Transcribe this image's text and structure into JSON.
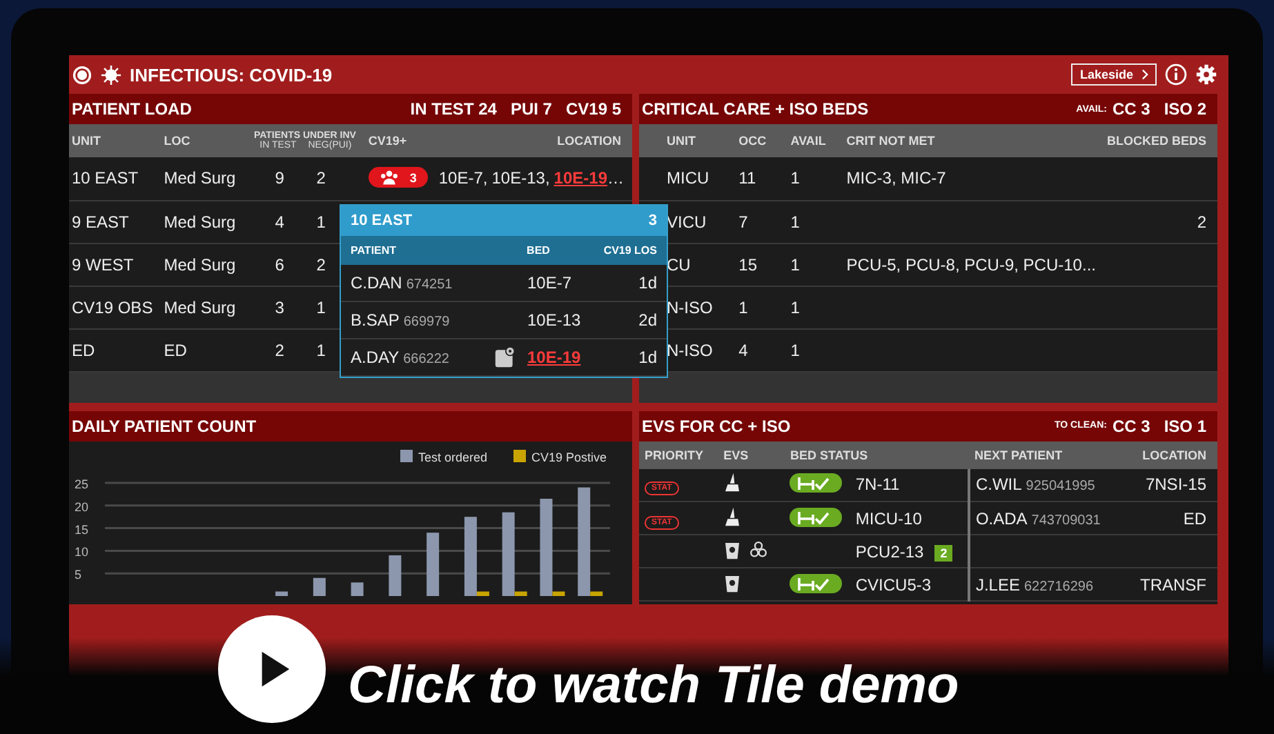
{
  "app_bar": {
    "title": "INFECTIOUS: COVID-19",
    "site_button": "Lakeside"
  },
  "patient_load": {
    "title": "PATIENT LOAD",
    "stats": [
      "IN TEST 24",
      "PUI 7",
      "CV19 5"
    ],
    "columns": {
      "unit": "UNIT",
      "loc": "LOC",
      "group": "PATIENTS UNDER INV",
      "in_test": "IN TEST",
      "neg_pui": "NEG(PUI)",
      "cv19": "CV19+",
      "location": "LOCATION"
    },
    "rows": [
      {
        "unit": "10 EAST",
        "loc": "Med Surg",
        "in_test": "9",
        "neg_pui": "2",
        "cv19_count": "3",
        "beds": [
          {
            "bed": "10E-7",
            "alert": false
          },
          {
            "bed": "10E-13",
            "alert": false
          },
          {
            "bed": "10E-19",
            "alert": true
          }
        ],
        "separator": ",",
        "more": "…"
      },
      {
        "unit": "9 EAST",
        "loc": "Med Surg",
        "in_test": "4",
        "neg_pui": "1"
      },
      {
        "unit": "9 WEST",
        "loc": "Med Surg",
        "in_test": "6",
        "neg_pui": "2"
      },
      {
        "unit": "CV19 OBS",
        "loc": "Med Surg",
        "in_test": "3",
        "neg_pui": "1"
      },
      {
        "unit": "ED",
        "loc": "ED",
        "in_test": "2",
        "neg_pui": "1"
      }
    ]
  },
  "popup": {
    "title": "10 EAST",
    "count": "3",
    "columns": [
      "PATIENT",
      "BED",
      "CV19 LOS"
    ],
    "rows": [
      {
        "name": "C.DAN",
        "mrn": "674251",
        "bed": "10E-7",
        "iso": false,
        "alert": false,
        "los": "1d"
      },
      {
        "name": "B.SAP",
        "mrn": "669979",
        "bed": "10E-13",
        "iso": false,
        "alert": false,
        "los": "2d"
      },
      {
        "name": "A.DAY",
        "mrn": "666222",
        "bed": "10E-19",
        "iso": true,
        "alert": true,
        "los": "1d"
      }
    ]
  },
  "critical_care": {
    "title": "CRITICAL CARE + ISO BEDS",
    "stats_label": "AVAIL:",
    "stats": [
      "CC 3",
      "ISO 2"
    ],
    "columns": [
      "UNIT",
      "OCC",
      "AVAIL",
      "CRIT NOT MET",
      "BLOCKED BEDS"
    ],
    "rows": [
      {
        "unit": "MICU",
        "occ": "11",
        "avail": "1",
        "crit_not_met": "MIC-3, MIC-7"
      },
      {
        "unit": "VICU",
        "occ": "7",
        "avail": "1",
        "blocked": "2"
      },
      {
        "unit": "CU",
        "occ": "15",
        "avail": "1",
        "crit_not_met": "PCU-5, PCU-8, PCU-9, PCU-10..."
      },
      {
        "unit": "N-ISO",
        "occ": "1",
        "avail": "1"
      },
      {
        "unit": "N-ISO",
        "occ": "4",
        "avail": "1"
      }
    ]
  },
  "daily_count": {
    "title": "DAILY PATIENT COUNT",
    "chart_data": {
      "type": "bar",
      "ylim": [
        0,
        25
      ],
      "yticks": [
        5,
        10,
        15,
        20,
        25
      ],
      "grid": true,
      "legend": "top-right",
      "series": [
        {
          "name": "Test ordered",
          "color": "#8c97ad",
          "values": [
            0,
            0,
            0,
            0,
            1,
            4,
            3,
            9,
            14,
            17.5,
            18.5,
            21.5,
            24
          ]
        },
        {
          "name": "CV19 Postive",
          "color": "#c9a400",
          "values": [
            0,
            0,
            0,
            0,
            0,
            0,
            0,
            0,
            0,
            1,
            1,
            1,
            1
          ]
        }
      ]
    }
  },
  "evs": {
    "title": "EVS FOR CC + ISO",
    "stats_label": "TO CLEAN:",
    "stats": [
      "CC 3",
      "ISO 1"
    ],
    "columns": [
      "PRIORITY",
      "EVS",
      "BED STATUS",
      "NEXT PATIENT",
      "LOCATION"
    ],
    "rows": [
      {
        "priority": "STAT",
        "evs": [
          {
            "kind": "broom"
          }
        ],
        "ready": true,
        "bed": "7N-11",
        "patient": "C.WIL",
        "id": "925041995",
        "location": "7NSI-15"
      },
      {
        "priority": "STAT",
        "evs": [
          {
            "kind": "broom"
          }
        ],
        "ready": true,
        "bed": "MICU-10",
        "patient": "O.ADA",
        "id": "743709031",
        "location": "ED"
      },
      {
        "evs": [
          {
            "kind": "bin"
          },
          {
            "kind": "biohazard"
          }
        ],
        "ready": false,
        "bed": "PCU2-13",
        "count": "2"
      },
      {
        "evs": [
          {
            "kind": "bin"
          }
        ],
        "ready": true,
        "bed": "CVICU5-3",
        "patient": "J.LEE",
        "id": "622716296",
        "location": "TRANSF"
      }
    ]
  },
  "video_overlay": {
    "caption": "Click to watch Tile demo"
  }
}
